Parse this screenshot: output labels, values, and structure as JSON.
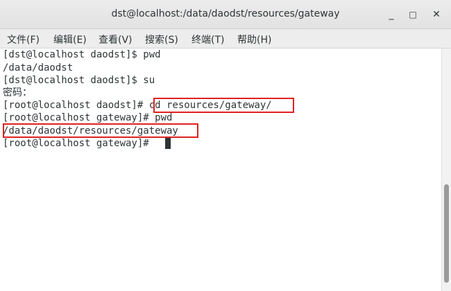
{
  "window": {
    "title": "dst@localhost:/data/daodst/resources/gateway",
    "minimize_glyph": "_",
    "maximize_glyph": "□",
    "close_glyph": "✕"
  },
  "menu": {
    "items": [
      "文件(F)",
      "编辑(E)",
      "查看(V)",
      "搜索(S)",
      "终端(T)",
      "帮助(H)"
    ]
  },
  "terminal": {
    "lines": [
      "[dst@localhost daodst]$ pwd",
      "/data/daodst",
      "[dst@localhost daodst]$ su",
      "密码：",
      "[root@localhost daodst]# cd resources/gateway/",
      "[root@localhost gateway]# pwd",
      "/data/daodst/resources/gateway",
      "[root@localhost gateway]# "
    ]
  },
  "colors": {
    "highlight": "#e02020",
    "text": "#2e3436",
    "background": "#ffffff"
  }
}
